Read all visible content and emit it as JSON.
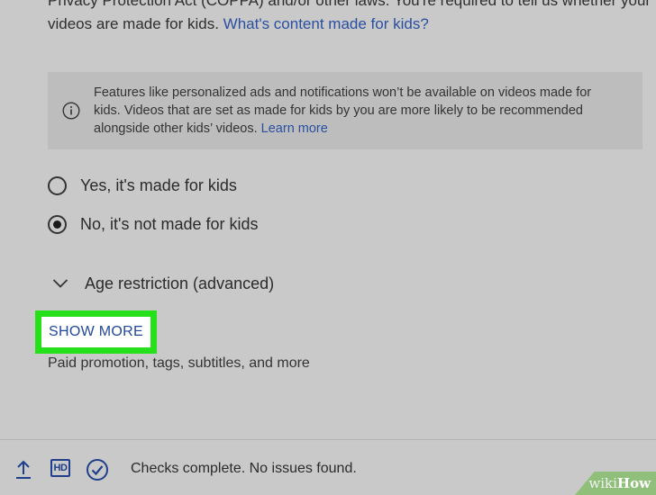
{
  "intro": {
    "line0": "Children's Online Privacy Protection Act (COPPA) and/or other laws...",
    "line1": "Privacy Protection Act (COPPA) and/or other laws. You're required to tell us whether your",
    "line2_text": "videos are made for kids.",
    "line2_link": "What's content made for kids?"
  },
  "notice": {
    "icon": "info-icon",
    "line1": "Features like personalized ads and notifications won’t be available on videos made for",
    "line2": "kids. Videos that are set as made for kids by you are more likely to be recommended",
    "line3_text": "alongside other kids’ videos.",
    "line3_link": "Learn more"
  },
  "audience": {
    "options": [
      {
        "label": "Yes, it's made for kids",
        "selected": false
      },
      {
        "label": "No, it's not made for kids",
        "selected": true
      }
    ]
  },
  "age_restriction": {
    "label": "Age restriction (advanced)",
    "icon": "chevron-down-icon"
  },
  "show_more": {
    "label": "SHOW MORE",
    "highlight_color": "#27e01c",
    "subtext": "Paid promotion, tags, subtitles, and more"
  },
  "footer": {
    "icons": [
      "upload-icon",
      "hd-icon",
      "check-circle-icon"
    ],
    "hd_label": "HD",
    "status": "Checks complete. No issues found."
  },
  "watermark": {
    "wiki": "wiki",
    "how": "How"
  },
  "colors": {
    "background": "#c9c9c9",
    "link": "#2a4fa0",
    "accent_blue": "#1f3f8a"
  }
}
